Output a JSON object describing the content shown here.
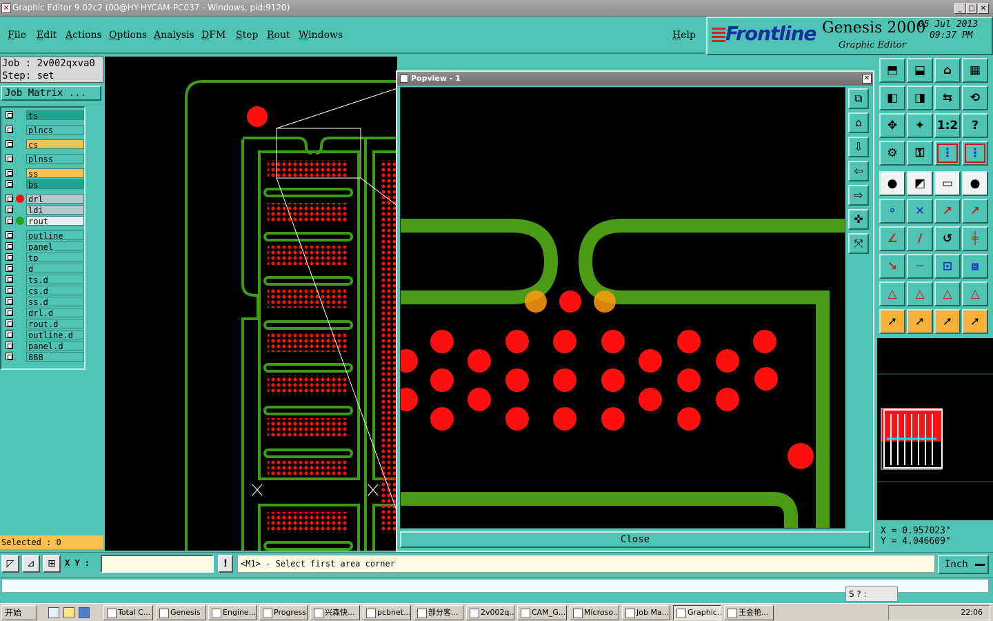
{
  "window": {
    "title": "Graphic Editor 9.02c2 (00@HY-HYCAM-PC037 - Windows, pid:9120)",
    "icon": "app-icon",
    "controls": [
      "_",
      "□",
      "✕"
    ]
  },
  "menu": {
    "items": [
      "File",
      "Edit",
      "Actions",
      "Options",
      "Analysis",
      "DFM",
      "Step",
      "Rout",
      "Windows"
    ],
    "help": "Help"
  },
  "brand": {
    "logo": "Frontline",
    "product": "Genesis 2000",
    "subtitle": "Graphic Editor",
    "date": "05 Jul 2013",
    "time": "09:37 PM",
    "colors": {
      "logo": "#1a2f9f",
      "stripes": "#d92020"
    }
  },
  "job": {
    "job_line": "Job : 2v002qxva0",
    "step_line": "Step: set",
    "matrix_button": "Job Matrix ..."
  },
  "layers": [
    {
      "name": "ts",
      "color": "#1fa58f",
      "dot": ""
    },
    {
      "name": "plncs",
      "color": "#4fc3b4",
      "dot": ""
    },
    {
      "name": "cs",
      "color": "#f9c04a",
      "dot": ""
    },
    {
      "name": "plnss",
      "color": "#4fc3b4",
      "dot": ""
    },
    {
      "name": "ss",
      "color": "#f9c04a",
      "dot": ""
    },
    {
      "name": "bs",
      "color": "#1fa58f",
      "dot": ""
    },
    {
      "name": "drl",
      "color": "#b8c8cc",
      "dot": "#ff1010"
    },
    {
      "name": "ldi",
      "color": "#b8c8cc",
      "dot": ""
    },
    {
      "name": "rout",
      "color": "#e6eceb",
      "dot": "#22a31f"
    },
    {
      "name": "outline",
      "color": "#4fc3b4",
      "dot": ""
    },
    {
      "name": "panel",
      "color": "#4fc3b4",
      "dot": ""
    },
    {
      "name": "tp",
      "color": "#4fc3b4",
      "dot": ""
    },
    {
      "name": "d",
      "color": "#4fc3b4",
      "dot": ""
    },
    {
      "name": "ts.d",
      "color": "#4fc3b4",
      "dot": ""
    },
    {
      "name": "cs.d",
      "color": "#4fc3b4",
      "dot": ""
    },
    {
      "name": "ss.d",
      "color": "#4fc3b4",
      "dot": ""
    },
    {
      "name": "drl.d",
      "color": "#4fc3b4",
      "dot": ""
    },
    {
      "name": "rout.d",
      "color": "#4fc3b4",
      "dot": ""
    },
    {
      "name": "outline.d",
      "color": "#4fc3b4",
      "dot": ""
    },
    {
      "name": "panel.d",
      "color": "#4fc3b4",
      "dot": ""
    },
    {
      "name": "888",
      "color": "#4fc3b4",
      "dot": ""
    }
  ],
  "selected": "Selected : 0",
  "popview": {
    "title": "Popview - 1",
    "close_label": "Close",
    "tools": [
      "zoom-home-icon",
      "zoom-in-area-icon",
      "zoom-out-icon",
      "pan-left-icon",
      "pan-right-icon",
      "fit-all-icon",
      "fit-profile-icon"
    ]
  },
  "tools": [
    [
      "zoom-home-icon",
      "zoom-down-icon",
      "home-icon",
      "grid-icon"
    ],
    [
      "pan-left-icon",
      "pan-right-icon",
      "pan-both-icon",
      "snap-icon"
    ],
    [
      "fit-icon",
      "center-icon",
      "scale-1-2-icon",
      "help-query-icon"
    ],
    [
      "settings-icon",
      "key-icon",
      "route-a-icon",
      "route-b-icon"
    ],
    [
      "pad-add-icon",
      "draw-line-icon",
      "measure-icon",
      "dot-icon"
    ],
    [
      "node-icon",
      "delete-icon",
      "move-icon",
      "copy-icon"
    ],
    [
      "angle-icon",
      "line-icon",
      "arc-icon",
      "split-icon"
    ],
    [
      "resize-icon",
      "minus-icon",
      "center-mark-icon",
      "group-icon"
    ],
    [
      "tri-a-icon",
      "tri-b-icon",
      "tri-c-icon",
      "tri-d-icon"
    ],
    [
      "select-icon",
      "select-box-icon",
      "select-ring-icon",
      "select-node-icon"
    ]
  ],
  "coords": {
    "x_line": "X = 0.957023\"",
    "y_line": "Y = 4.046609\""
  },
  "command": {
    "xy_label": "X Y :",
    "xy_value": "",
    "prompt": "<M1> - Select first area corner",
    "unit": "Inch"
  },
  "ime": {
    "label": "S ? :"
  },
  "taskbar": {
    "start": "开始",
    "tasks": [
      "Total C...",
      "Genesis",
      "Engine...",
      "Progress",
      "兴森快...",
      "pcbnet...",
      "部分客...",
      "2v002q...",
      "CAM_G...",
      "Microso...",
      "Job Ma...",
      "Graphic...",
      "王金艳..."
    ],
    "clock": "22:06"
  }
}
